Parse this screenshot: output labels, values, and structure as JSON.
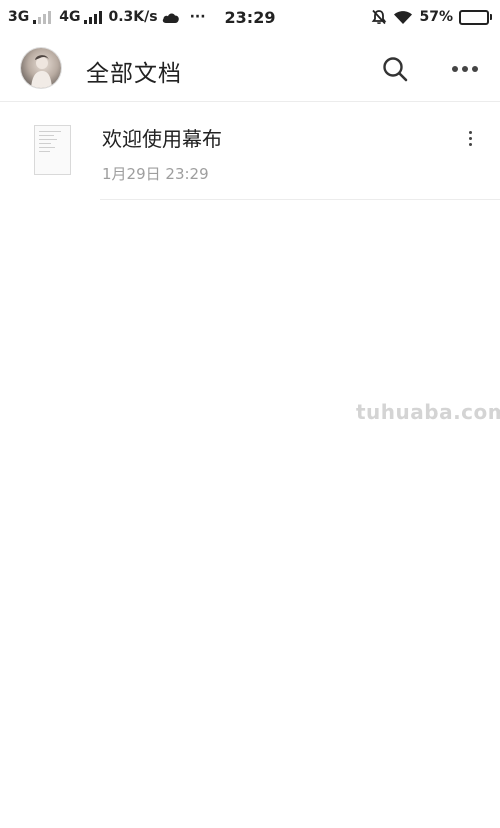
{
  "status_bar": {
    "network_1": "3G",
    "network_2": "4G",
    "speed": "0.3K/s",
    "dots": "···",
    "time": "23:29",
    "battery_percent": "57%",
    "battery_level": 0.57,
    "icons": [
      "signal-weak-icon",
      "signal-strong-icon",
      "cloud-icon",
      "mute-bell-icon",
      "wifi-icon",
      "battery-icon"
    ]
  },
  "header": {
    "title": "全部文档",
    "icons": [
      "avatar",
      "search-icon",
      "more-icon"
    ]
  },
  "documents": [
    {
      "title": "欢迎使用幕布",
      "time": "1月29日 23:29"
    }
  ],
  "watermark": "tuhuaba.com"
}
